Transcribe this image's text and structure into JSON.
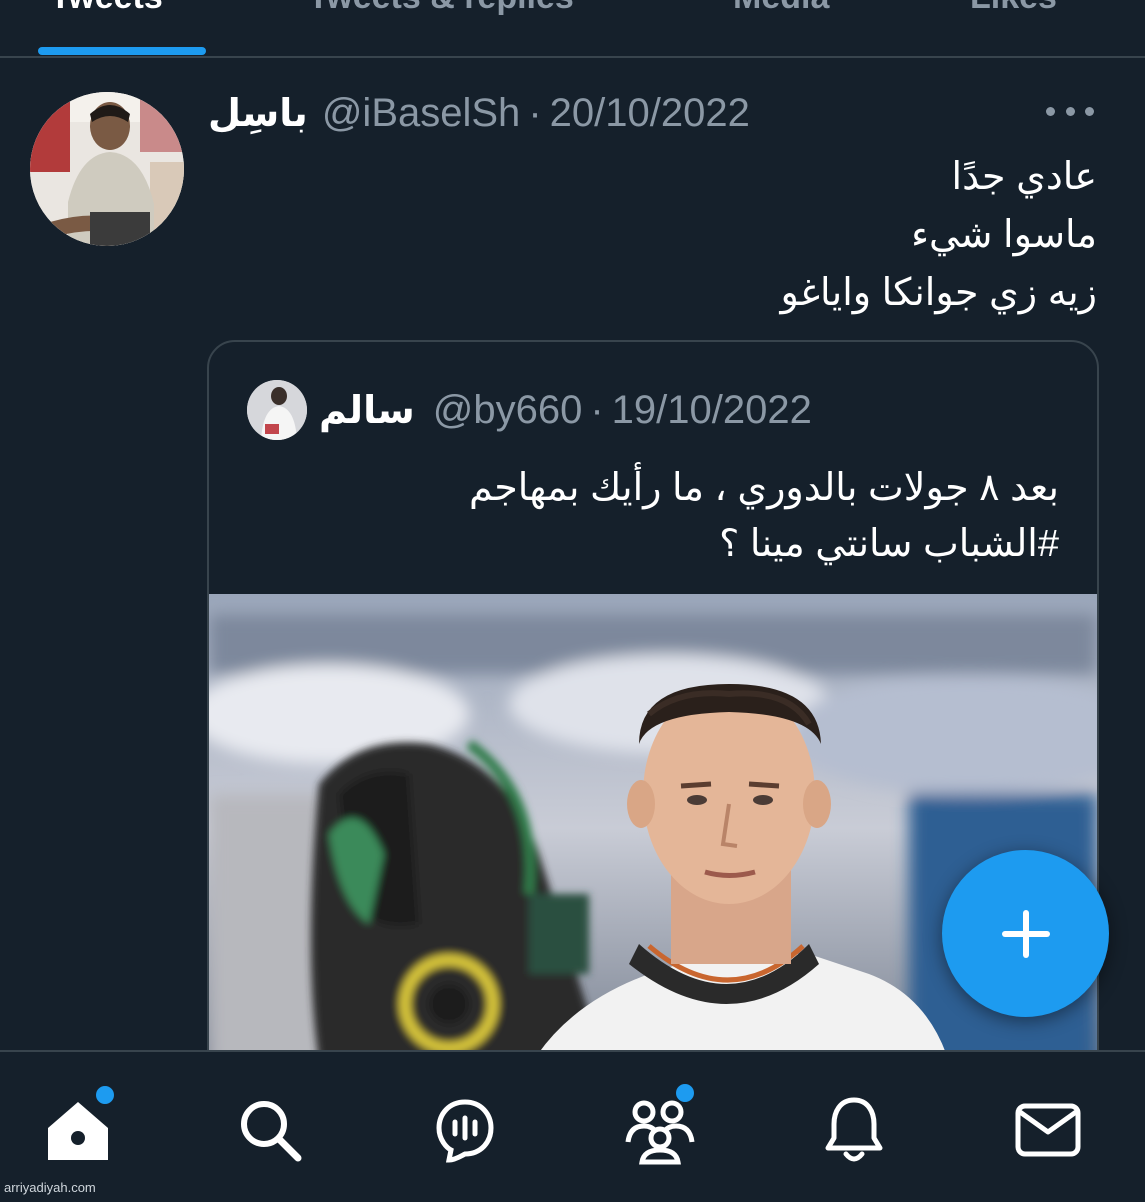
{
  "tabs": [
    {
      "label": "Tweets",
      "active": true
    },
    {
      "label": "Tweets & replies",
      "active": false
    },
    {
      "label": "Media",
      "active": false
    },
    {
      "label": "Likes",
      "active": false
    }
  ],
  "tweet": {
    "display_name": "باسِل",
    "handle": "@iBaselSh",
    "separator": "·",
    "date": "20/10/2022",
    "lines": [
      "عادي جدًا",
      "ماسوا شيء",
      "زيه زي جوانكا واياغو"
    ],
    "more_icon": "more-dots-icon"
  },
  "quote": {
    "display_name": "سالم",
    "handle": "@by660",
    "separator": "·",
    "date": "19/10/2022",
    "lines": [
      "بعد ٨ جولات بالدوري ، ما رأيك بمهاجم",
      "#الشباب سانتي مينا ؟"
    ]
  },
  "fab": {
    "icon": "plus-icon"
  },
  "bottom_nav": [
    {
      "name": "home",
      "icon": "home-icon",
      "notification_dot": true
    },
    {
      "name": "search",
      "icon": "search-icon",
      "notification_dot": false
    },
    {
      "name": "spaces",
      "icon": "spaces-icon",
      "notification_dot": false
    },
    {
      "name": "communities",
      "icon": "communities-icon",
      "notification_dot": true
    },
    {
      "name": "notifications",
      "icon": "bell-icon",
      "notification_dot": false
    },
    {
      "name": "messages",
      "icon": "mail-icon",
      "notification_dot": false
    }
  ],
  "watermark": "arriyadiyah.com",
  "colors": {
    "background": "#15202b",
    "accent": "#1d9bf0",
    "secondary_text": "#8b98a5",
    "border": "#38444d"
  }
}
